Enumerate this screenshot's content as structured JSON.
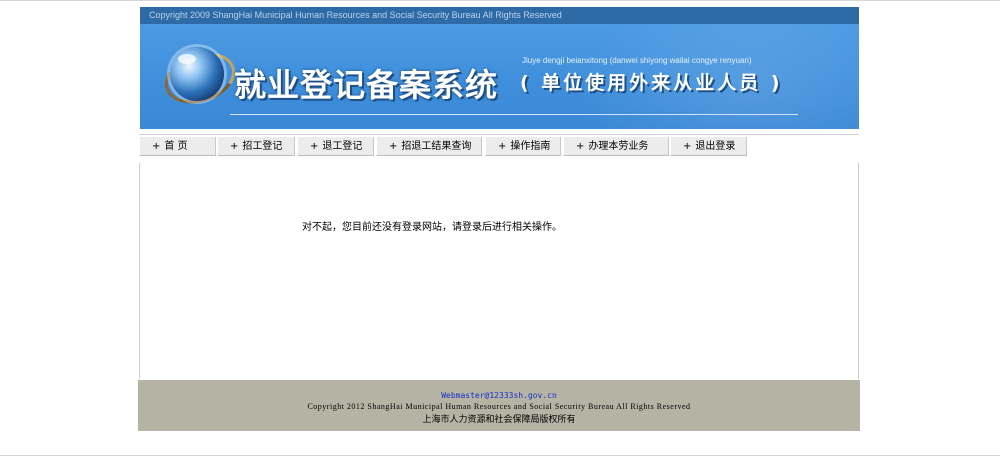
{
  "header": {
    "copyright": "Copyright 2009 ShangHai Municipal Human Resources and Social Security Bureau All Rights Reserved",
    "title": "就业登记备案系统",
    "subtitle": "( 单位使用外来从业人员 )",
    "pinyin": "Jiuye dengji beianxitong (danwei shiyong wailai congye renyuan)"
  },
  "nav": {
    "items": [
      {
        "plus": "+",
        "label": "首 页"
      },
      {
        "plus": "+",
        "label": "招工登记"
      },
      {
        "plus": "+",
        "label": "退工登记"
      },
      {
        "plus": "+",
        "label": "招退工结果查询"
      },
      {
        "plus": "+",
        "label": "操作指南"
      },
      {
        "plus": "+",
        "label": "办理本劳业务"
      },
      {
        "plus": "+",
        "label": "退出登录"
      }
    ]
  },
  "main": {
    "message": "对不起，您目前还没有登录网站，请登录后进行相关操作。"
  },
  "footer": {
    "email": "Webmaster@12333sh.gov.cn",
    "copyright": "Copyright 2012 ShangHai Municipal Human Resources and Social Security Bureau All Rights Reserved",
    "org": "上海市人力资源和社会保障局版权所有"
  },
  "colors": {
    "banner": "#3f8fdc",
    "copy_bar": "#2d6aa6",
    "nav_bg": "#ececec",
    "footer_bg": "#b5b3a3",
    "link": "#1a2ec8"
  }
}
